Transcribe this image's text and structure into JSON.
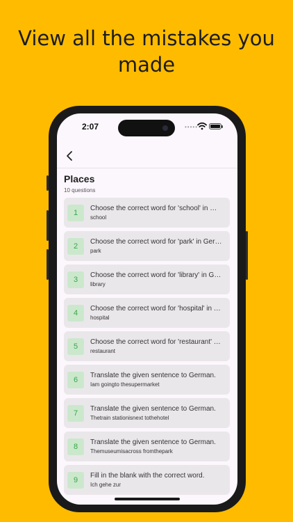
{
  "headline": {
    "line1": "View all the mistakes you",
    "line2": "made"
  },
  "status_bar": {
    "time": "2:07",
    "signal_dots": "•••••",
    "icons": [
      "wifi-icon",
      "battery-icon"
    ]
  },
  "header": {
    "back_icon": "chevron-left-icon",
    "title": "Places",
    "subtitle": "10 questions"
  },
  "questions": [
    {
      "number": "1",
      "question": "Choose the correct word for 'school' in German.",
      "answer": "school"
    },
    {
      "number": "2",
      "question": "Choose the correct word for 'park' in German.",
      "answer": "park"
    },
    {
      "number": "3",
      "question": "Choose the correct word for 'library' in German.",
      "answer": "library"
    },
    {
      "number": "4",
      "question": "Choose the correct word for 'hospital' in German.",
      "answer": "hospital"
    },
    {
      "number": "5",
      "question": "Choose the correct word for 'restaurant' in German.",
      "answer": "restaurant"
    },
    {
      "number": "6",
      "question": "Translate the given sentence to German.",
      "answer": "Iam goingto thesupermarket"
    },
    {
      "number": "7",
      "question": "Translate the given sentence to German.",
      "answer": "Thetrain stationisnext tothehotel"
    },
    {
      "number": "8",
      "question": "Translate the given sentence to German.",
      "answer": "Themuseumisacross fromthepark"
    },
    {
      "number": "9",
      "question": "Fill in the blank with the correct word.",
      "answer": "Ich gehe zur"
    }
  ],
  "colors": {
    "background": "#FFBB00",
    "number_badge_bg": "#CBE8CC",
    "number_badge_text": "#3AA54A",
    "card_bg": "#EAE7EA"
  }
}
